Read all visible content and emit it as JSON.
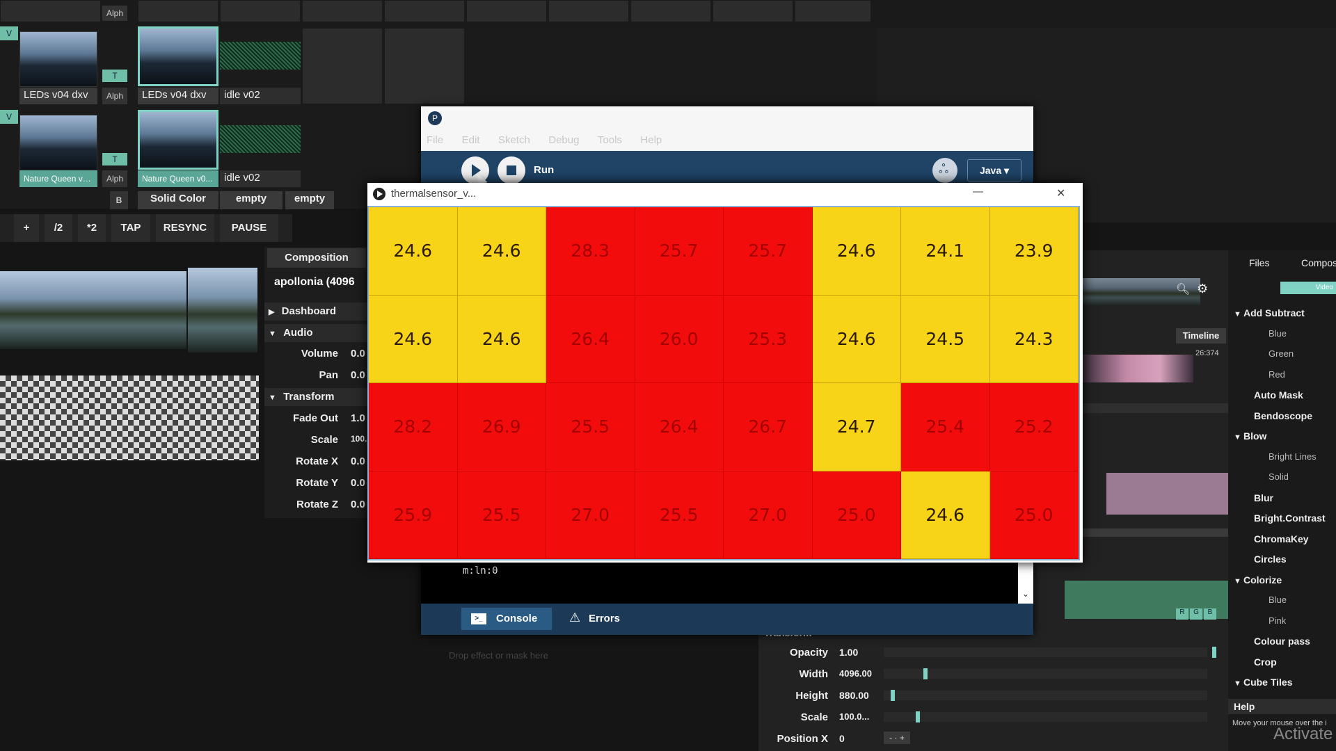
{
  "deck": {
    "alph_label": "Alph",
    "rows": [
      {
        "v_tag": "V",
        "t_tag": "T",
        "clips": [
          {
            "label": "LEDs v04 dxv",
            "selected": false
          },
          {
            "label": "LEDs v04 dxv",
            "selected": true
          },
          {
            "label": "idle v02",
            "selected": false
          }
        ]
      },
      {
        "v_tag": "V",
        "t_tag": "T",
        "clips": [
          {
            "label": "Nature Queen v0...",
            "selected": false
          },
          {
            "label": "Nature Queen v0...",
            "selected": true
          },
          {
            "label": "idle v02",
            "selected": false
          }
        ]
      }
    ],
    "bottom_row": {
      "b_label": "B",
      "cells": [
        "Solid Color",
        "empty",
        "empty"
      ]
    }
  },
  "transport": {
    "buttons": [
      "+",
      "/2",
      "*2",
      "TAP",
      "RESYNC",
      "PAUSE"
    ]
  },
  "composition_panel": {
    "tab": "Composition",
    "name": "apollonia (4096",
    "sections": [
      {
        "title": "Dashboard",
        "expanded": false
      },
      {
        "title": "Audio",
        "expanded": true
      },
      {
        "title": "Transform",
        "expanded": true
      }
    ],
    "audio_props": [
      {
        "label": "Volume",
        "value": "0.0"
      },
      {
        "label": "Pan",
        "value": "0.0"
      }
    ],
    "transform_props": [
      {
        "label": "Fade Out",
        "value": "1.0"
      },
      {
        "label": "Scale",
        "value": "100."
      },
      {
        "label": "Rotate X",
        "value": "0.0"
      },
      {
        "label": "Rotate Y",
        "value": "0.0"
      },
      {
        "label": "Rotate Z",
        "value": "0.0"
      }
    ]
  },
  "ide": {
    "menu": [
      "File",
      "Edit",
      "Sketch",
      "Debug",
      "Tools",
      "Help"
    ],
    "run_label": "Run",
    "mode": "Java ▾",
    "console_lines": [
      "m:ln:0",
      "m:ln:0"
    ],
    "console_tab": "Console",
    "errors_tab": "Errors"
  },
  "sketch": {
    "title": "thermalsensor_v...",
    "minimize": "—",
    "close": "✕",
    "colors": {
      "warm": "#f7d417",
      "hot": "#f20c0c"
    },
    "grid": [
      [
        {
          "v": "24.6",
          "hot": false
        },
        {
          "v": "24.6",
          "hot": false
        },
        {
          "v": "28.3",
          "hot": true
        },
        {
          "v": "25.7",
          "hot": true
        },
        {
          "v": "25.7",
          "hot": true
        },
        {
          "v": "24.6",
          "hot": false
        },
        {
          "v": "24.1",
          "hot": false
        },
        {
          "v": "23.9",
          "hot": false
        }
      ],
      [
        {
          "v": "24.6",
          "hot": false
        },
        {
          "v": "24.6",
          "hot": false
        },
        {
          "v": "26.4",
          "hot": true
        },
        {
          "v": "26.0",
          "hot": true
        },
        {
          "v": "25.3",
          "hot": true
        },
        {
          "v": "24.6",
          "hot": false
        },
        {
          "v": "24.5",
          "hot": false
        },
        {
          "v": "24.3",
          "hot": false
        }
      ],
      [
        {
          "v": "28.2",
          "hot": true
        },
        {
          "v": "26.9",
          "hot": true
        },
        {
          "v": "25.5",
          "hot": true
        },
        {
          "v": "26.4",
          "hot": true
        },
        {
          "v": "26.7",
          "hot": true
        },
        {
          "v": "24.7",
          "hot": false
        },
        {
          "v": "25.4",
          "hot": true
        },
        {
          "v": "25.2",
          "hot": true
        }
      ],
      [
        {
          "v": "25.9",
          "hot": true
        },
        {
          "v": "25.5",
          "hot": true
        },
        {
          "v": "27.0",
          "hot": true
        },
        {
          "v": "25.5",
          "hot": true
        },
        {
          "v": "27.0",
          "hot": true
        },
        {
          "v": "25.0",
          "hot": true
        },
        {
          "v": "24.6",
          "hot": false
        },
        {
          "v": "25.0",
          "hot": true
        }
      ]
    ]
  },
  "right_panel": {
    "tabs": [
      "Files",
      "Compos"
    ],
    "video_badge": "Video",
    "timeline_btn": "Timeline",
    "timecode": "26:374",
    "effects": [
      {
        "label": "Add Subtract",
        "kind": "group"
      },
      {
        "label": "Blue",
        "kind": "sub"
      },
      {
        "label": "Green",
        "kind": "sub"
      },
      {
        "label": "Red",
        "kind": "sub"
      },
      {
        "label": "Auto Mask",
        "kind": "item"
      },
      {
        "label": "Bendoscope",
        "kind": "item"
      },
      {
        "label": "Blow",
        "kind": "group"
      },
      {
        "label": "Bright Lines",
        "kind": "sub"
      },
      {
        "label": "Solid",
        "kind": "sub"
      },
      {
        "label": "Blur",
        "kind": "item"
      },
      {
        "label": "Bright.Contrast",
        "kind": "item"
      },
      {
        "label": "ChromaKey",
        "kind": "item"
      },
      {
        "label": "Circles",
        "kind": "item"
      },
      {
        "label": "Colorize",
        "kind": "group"
      },
      {
        "label": "Blue",
        "kind": "sub"
      },
      {
        "label": "Pink",
        "kind": "sub"
      },
      {
        "label": "Colour pass",
        "kind": "item"
      },
      {
        "label": "Crop",
        "kind": "item"
      },
      {
        "label": "Cube Tiles",
        "kind": "group"
      }
    ],
    "help_title": "Help",
    "help_text": "Move your mouse over the i",
    "activate_text": "Activate"
  },
  "clip_props": {
    "section": "Transform",
    "drop_hint": "Drop effect or mask here",
    "rgb": [
      "R",
      "G",
      "B"
    ],
    "rows": [
      {
        "label": "Opacity",
        "value": "1.00",
        "level": 1.0
      },
      {
        "label": "Width",
        "value": "4096.00",
        "level": 0.12
      },
      {
        "label": "Height",
        "value": "880.00",
        "level": 0.02
      },
      {
        "label": "Scale",
        "value": "100.0...",
        "level": 0.1
      },
      {
        "label": "Position X",
        "value": "0",
        "level": 0.0
      }
    ],
    "stepper": [
      "-",
      "+"
    ]
  }
}
